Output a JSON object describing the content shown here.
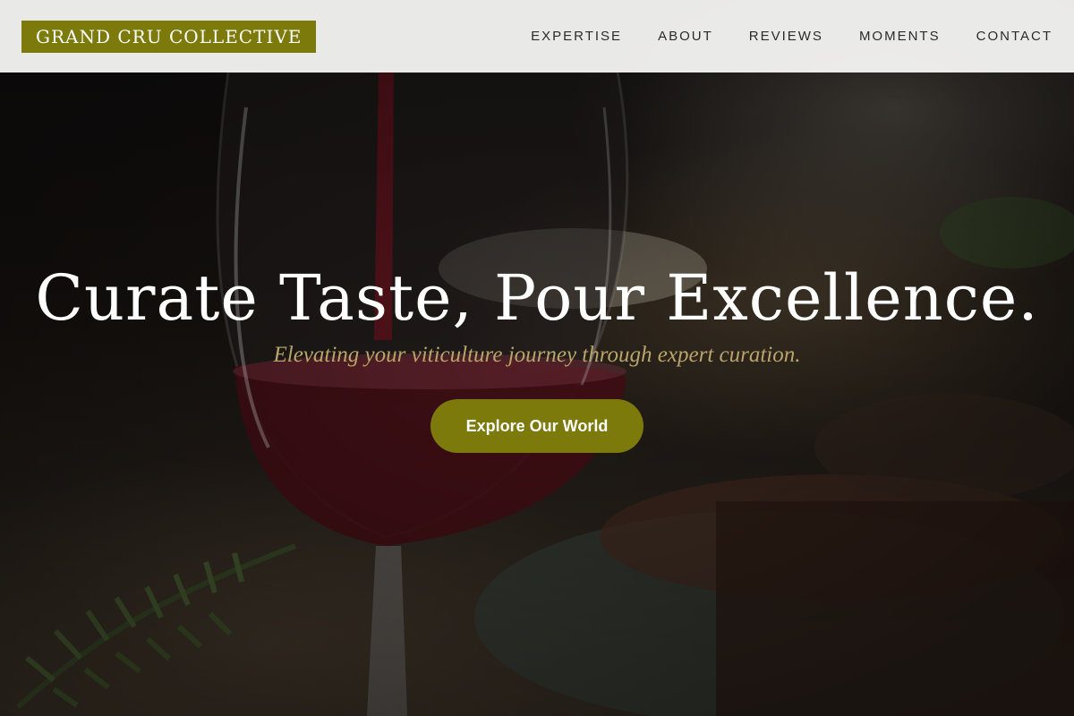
{
  "header": {
    "logo_text": "GRAND CRU COLLECTIVE",
    "nav": [
      {
        "label": "EXPERTISE"
      },
      {
        "label": "ABOUT"
      },
      {
        "label": "REVIEWS"
      },
      {
        "label": "MOMENTS"
      },
      {
        "label": "CONTACT"
      }
    ]
  },
  "hero": {
    "title": "Curate Taste, Pour Excellence.",
    "tagline": "Elevating your viticulture journey through expert curation.",
    "cta_label": "Explore Our World",
    "background_image": "red-wine-glass-with-food-photo"
  },
  "colors": {
    "accent": "#7b7a0b",
    "tagline": "#b9a46a",
    "header_bg": "#f6f6f4",
    "nav_text": "#2b2b2b"
  }
}
